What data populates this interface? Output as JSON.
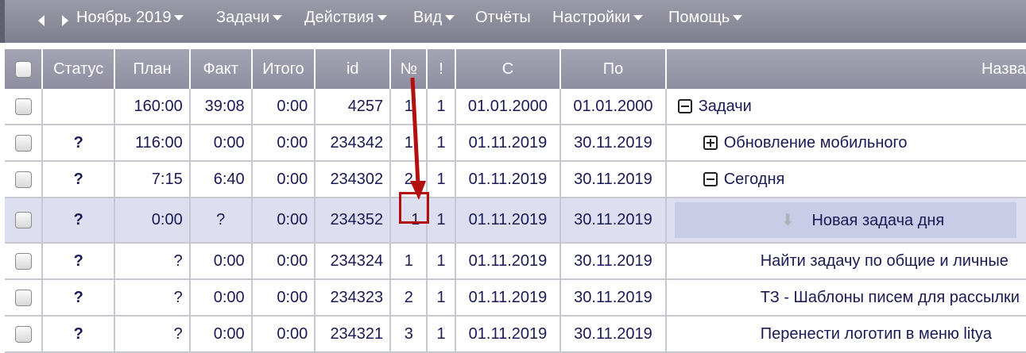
{
  "menu": {
    "month": "Ноябрь 2019",
    "items": [
      "Задачи",
      "Действия",
      "Вид",
      "Отчёты",
      "Настройки",
      "Помощь"
    ]
  },
  "columns": {
    "status": "Статус",
    "plan": "План",
    "fact": "Факт",
    "total": "Итого",
    "id": "id",
    "num": "№",
    "excl": "!",
    "from": "С",
    "to": "По",
    "name": "Назва"
  },
  "rows": [
    {
      "status": "",
      "plan": "160:00",
      "fact": "39:08",
      "total": "0:00",
      "id": "4257",
      "num": "1",
      "excl": "1",
      "from": "01.01.2000",
      "to": "01.01.2000",
      "name": "Задачи"
    },
    {
      "status": "?",
      "plan": "116:00",
      "fact": "0:00",
      "total": "0:00",
      "id": "234342",
      "num": "1",
      "excl": "1",
      "from": "01.11.2019",
      "to": "30.11.2019",
      "name": "Обновление мобильного"
    },
    {
      "status": "?",
      "plan": "7:15",
      "fact": "6:40",
      "total": "0:00",
      "id": "234302",
      "num": "2",
      "excl": "1",
      "from": "01.11.2019",
      "to": "30.11.2019",
      "name": "Сегодня"
    },
    {
      "status": "?",
      "plan": "0:00",
      "fact": "?",
      "total": "0:00",
      "id": "234352",
      "num": "1",
      "excl": "1",
      "from": "01.11.2019",
      "to": "30.11.2019",
      "name": "Новая задача дня"
    },
    {
      "status": "?",
      "plan": "?",
      "fact": "0:00",
      "total": "0:00",
      "id": "234324",
      "num": "1",
      "excl": "1",
      "from": "01.11.2019",
      "to": "30.11.2019",
      "name": "Найти задачу по общие и личные"
    },
    {
      "status": "?",
      "plan": "?",
      "fact": "0:00",
      "total": "0:00",
      "id": "234323",
      "num": "2",
      "excl": "1",
      "from": "01.11.2019",
      "to": "30.11.2019",
      "name": "ТЗ - Шаблоны писем для рассылки"
    },
    {
      "status": "?",
      "plan": "?",
      "fact": "0:00",
      "total": "0:00",
      "id": "234321",
      "num": "3",
      "excl": "1",
      "from": "01.11.2019",
      "to": "30.11.2019",
      "name": "Перенести логотип в меню litya"
    }
  ],
  "colors": {
    "accent_red": "#b30f0f",
    "status_red": "#e01010",
    "header_bg": "#9a9aa8"
  }
}
